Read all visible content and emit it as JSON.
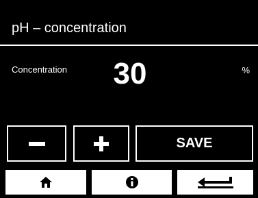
{
  "header": {
    "title": "pH – concentration"
  },
  "reading": {
    "label": "Concentration",
    "value": "30",
    "unit": "%"
  },
  "controls": {
    "save_label": "SAVE",
    "decrement_icon": "minus-icon",
    "increment_icon": "plus-icon"
  },
  "nav": {
    "home_icon": "home-icon",
    "info_icon": "info-icon",
    "back_icon": "return-arrow-icon"
  },
  "colors": {
    "background": "#000000",
    "foreground": "#ffffff"
  }
}
